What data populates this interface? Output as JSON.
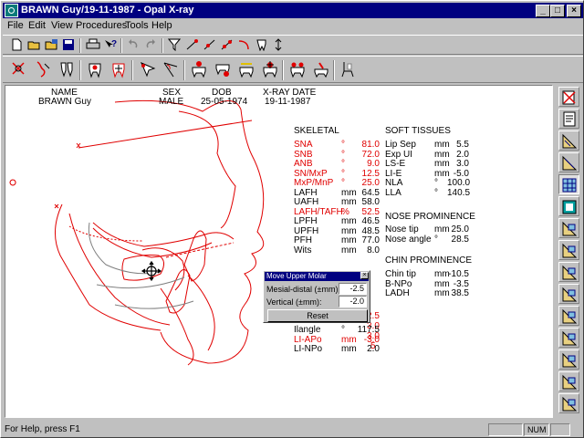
{
  "window": {
    "title": "BRAWN Guy/19-11-1987 - Opal X-ray"
  },
  "menu": [
    "File",
    "Edit",
    "View",
    "Procedures",
    "Tools",
    "Help"
  ],
  "patient": {
    "headers": [
      "NAME",
      "SEX",
      "DOB",
      "X-RAY DATE"
    ],
    "values": [
      "BRAWN Guy",
      "MALE",
      "25-05-1974",
      "19-11-1987"
    ]
  },
  "skeletal": {
    "title": "SKELETAL",
    "rows": [
      {
        "name": "SNA",
        "unit": "°",
        "value": "81.0",
        "red": true
      },
      {
        "name": "SNB",
        "unit": "°",
        "value": "72.0",
        "red": true
      },
      {
        "name": "ANB",
        "unit": "°",
        "value": "9.0",
        "red": true
      },
      {
        "name": "SN/MxP",
        "unit": "°",
        "value": "12.5",
        "red": true
      },
      {
        "name": "MxP/MnP",
        "unit": "°",
        "value": "25.0",
        "red": true
      },
      {
        "name": "LAFH",
        "unit": "mm",
        "value": "64.5",
        "red": false
      },
      {
        "name": "UAFH",
        "unit": "mm",
        "value": "58.0",
        "red": false
      },
      {
        "name": "LAFH/TAFH",
        "unit": "%",
        "value": "52.5",
        "red": true
      },
      {
        "name": "LPFH",
        "unit": "mm",
        "value": "46.5",
        "red": false
      },
      {
        "name": "UPFH",
        "unit": "mm",
        "value": "48.5",
        "red": false
      },
      {
        "name": "PFH",
        "unit": "mm",
        "value": "77.0",
        "red": false
      },
      {
        "name": "Wits",
        "unit": "mm",
        "value": "8.0",
        "red": false
      }
    ]
  },
  "dental_partial": {
    "rows": [
      {
        "name": "Ilangle",
        "unit": "°",
        "value": "117.5",
        "red": false
      },
      {
        "name": "LI-APo",
        "unit": "mm",
        "value": "-3.0",
        "red": true
      },
      {
        "name": "LI-NPo",
        "unit": "mm",
        "value": "2.0",
        "red": false
      }
    ],
    "peek": [
      "2.5",
      "3.0",
      "3.0",
      "5"
    ]
  },
  "soft_tissues": {
    "title": "SOFT TISSUES",
    "rows": [
      {
        "name": "Lip Sep",
        "unit": "mm",
        "value": "5.5"
      },
      {
        "name": "Exp UI",
        "unit": "mm",
        "value": "2.0"
      },
      {
        "name": "LS-E",
        "unit": "mm",
        "value": "3.0"
      },
      {
        "name": "LI-E",
        "unit": "mm",
        "value": "-5.0"
      },
      {
        "name": "NLA",
        "unit": "°",
        "value": "100.0"
      },
      {
        "name": "LLA",
        "unit": "°",
        "value": "140.5"
      }
    ]
  },
  "nose": {
    "title": "NOSE PROMINENCE",
    "rows": [
      {
        "name": "Nose tip",
        "unit": "mm",
        "value": "25.0"
      },
      {
        "name": "Nose angle",
        "unit": "°",
        "value": "28.5"
      }
    ]
  },
  "chin": {
    "title": "CHIN PROMINENCE",
    "rows": [
      {
        "name": "Chin tip",
        "unit": "mm",
        "value": "-10.5"
      },
      {
        "name": "B-NPo",
        "unit": "mm",
        "value": "-3.5"
      },
      {
        "name": "LADH",
        "unit": "mm",
        "value": "38.5"
      }
    ]
  },
  "dialog": {
    "title": "Move Upper Molar",
    "mesial_label": "Mesial-distal (±mm):",
    "mesial_value": "-2.5",
    "vertical_label": "Vertical (±mm):",
    "vertical_value": "-2.0",
    "reset_label": "Reset"
  },
  "status": {
    "help": "For Help, press F1",
    "num": "NUM"
  },
  "colors": {
    "title_bar": "#000080",
    "trace": "#e00000",
    "face_bg": "#c0c0c0"
  }
}
